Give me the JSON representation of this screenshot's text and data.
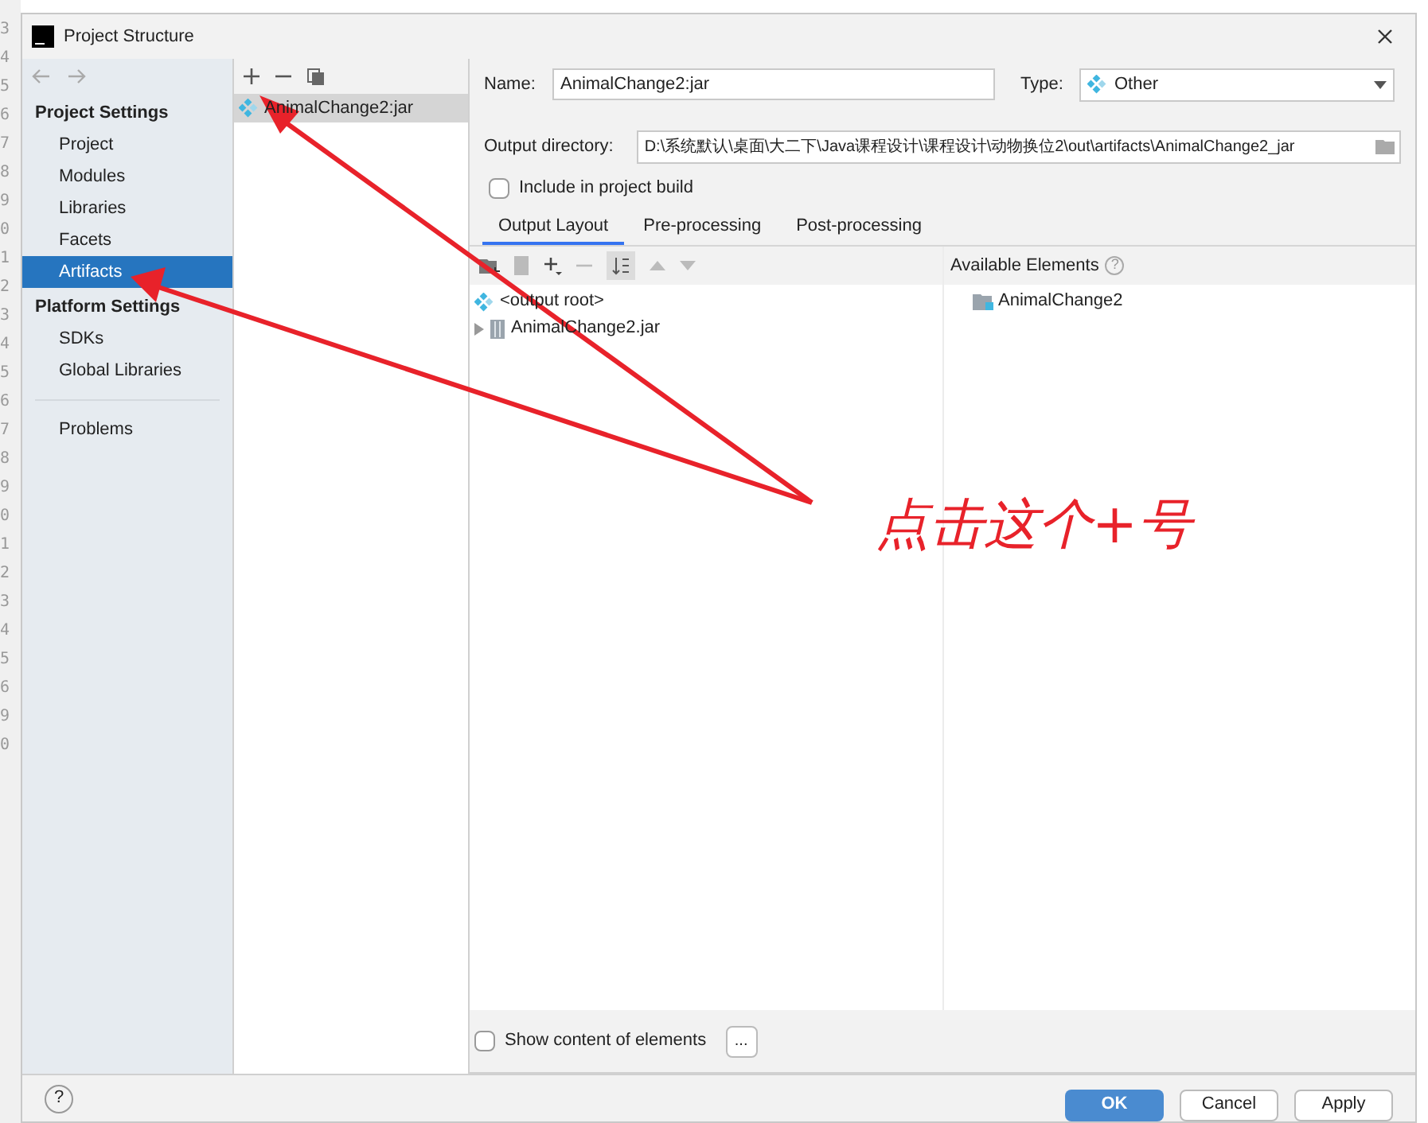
{
  "editor_gutter": [
    "3",
    "4",
    "5",
    "6",
    "7",
    "8",
    "9",
    "0",
    "1",
    "2",
    "3",
    "4",
    "5",
    "6",
    "7",
    "8",
    "9",
    "0",
    "1",
    "2",
    "3",
    "4",
    "5",
    "6",
    "9",
    "0"
  ],
  "window": {
    "title": "Project Structure"
  },
  "sidebar": {
    "sections": [
      {
        "title": "Project Settings",
        "items": [
          {
            "label": "Project",
            "selected": false
          },
          {
            "label": "Modules",
            "selected": false
          },
          {
            "label": "Libraries",
            "selected": false
          },
          {
            "label": "Facets",
            "selected": false
          },
          {
            "label": "Artifacts",
            "selected": true
          }
        ]
      },
      {
        "title": "Platform Settings",
        "items": [
          {
            "label": "SDKs",
            "selected": false
          },
          {
            "label": "Global Libraries",
            "selected": false
          }
        ]
      }
    ],
    "footer_items": [
      {
        "label": "Problems",
        "selected": false
      }
    ]
  },
  "artifacts": [
    {
      "label": "AnimalChange2:jar",
      "selected": true
    }
  ],
  "form": {
    "name_label": "Name:",
    "name_value": "AnimalChange2:jar",
    "type_label": "Type:",
    "type_value": "Other",
    "output_label": "Output directory:",
    "output_value": "D:\\系统默认\\桌面\\大二下\\Java课程设计\\课程设计\\动物换位2\\out\\artifacts\\AnimalChange2_jar",
    "include_label": "Include in project build",
    "include_checked": false
  },
  "tabs": [
    {
      "label": "Output Layout",
      "selected": true
    },
    {
      "label": "Pre-processing",
      "selected": false
    },
    {
      "label": "Post-processing",
      "selected": false
    }
  ],
  "layout_tree": [
    {
      "label": "<output root>",
      "kind": "root"
    },
    {
      "label": "AnimalChange2.jar",
      "kind": "jar"
    }
  ],
  "available": {
    "title": "Available Elements",
    "help": "?",
    "items": [
      {
        "label": "AnimalChange2"
      }
    ]
  },
  "show_content": {
    "label": "Show content of elements",
    "checked": false,
    "button": "..."
  },
  "footer": {
    "help": "?",
    "buttons": [
      {
        "label": "OK",
        "primary": true
      },
      {
        "label": "Cancel",
        "primary": false
      },
      {
        "label": "Apply",
        "primary": false
      }
    ]
  },
  "annotation": {
    "text": "点击这个+号"
  }
}
